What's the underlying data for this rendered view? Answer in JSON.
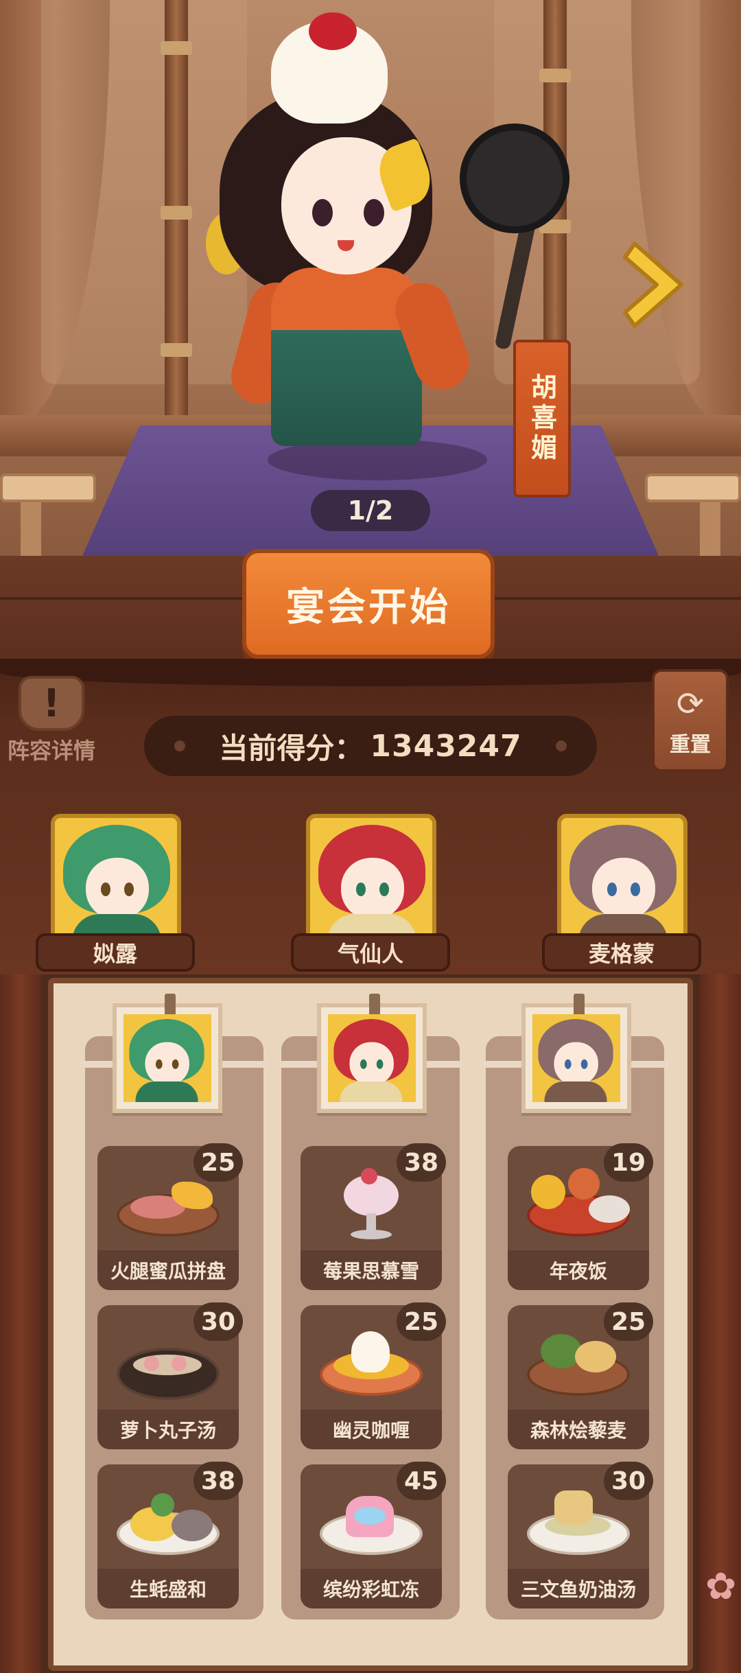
{
  "stage": {
    "character_name": "胡喜媚",
    "page_indicator": "1/2",
    "start_button": "宴会开始"
  },
  "controls": {
    "lineup_detail_label": "阵容详情",
    "reset_label": "重置"
  },
  "score": {
    "label": "当前得分：",
    "value": "1343247"
  },
  "team": [
    {
      "name": "姒露"
    },
    {
      "name": "气仙人"
    },
    {
      "name": "麦格蒙"
    }
  ],
  "menu": {
    "columns": [
      {
        "dishes": [
          {
            "name": "火腿蜜瓜拼盘",
            "count": "25"
          },
          {
            "name": "萝卜丸子汤",
            "count": "30"
          },
          {
            "name": "生蚝盛和",
            "count": "38"
          }
        ]
      },
      {
        "dishes": [
          {
            "name": "莓果思慕雪",
            "count": "38"
          },
          {
            "name": "幽灵咖喱",
            "count": "25"
          },
          {
            "name": "缤纷彩虹冻",
            "count": "45"
          }
        ]
      },
      {
        "dishes": [
          {
            "name": "年夜饭",
            "count": "19"
          },
          {
            "name": "森林烩藜麦",
            "count": "25"
          },
          {
            "name": "三文鱼奶油汤",
            "count": "30"
          }
        ]
      }
    ]
  },
  "colors": {
    "button_orange": "#df6b22",
    "wood_dark": "#4e2a1c",
    "board_cream": "#ead6bd",
    "portrait_gold": "#f3c43f"
  }
}
